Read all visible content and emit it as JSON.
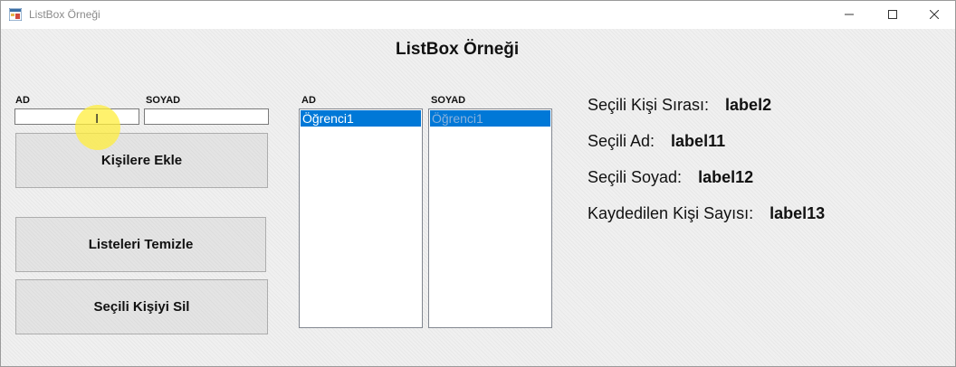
{
  "window": {
    "title": "ListBox Örneği"
  },
  "form": {
    "heading": "ListBox Örneği",
    "ad_label": "AD",
    "soyad_label": "SOYAD",
    "ad_value": "",
    "soyad_value": "",
    "buttons": {
      "add": "Kişilere Ekle",
      "clear": "Listeleri Temizle",
      "delete": "Seçili Kişiyi Sil"
    },
    "list_ad_label": "AD",
    "list_soyad_label": "SOYAD",
    "list_ad_items": [
      "Öğrenci1"
    ],
    "list_soyad_items": [
      "Öğrenci1"
    ],
    "info": {
      "index_label": "Seçili Kişi Sırası:",
      "index_value": "label2",
      "ad_label": "Seçili Ad:",
      "ad_value": "label11",
      "soyad_label": "Seçili Soyad:",
      "soyad_value": "label12",
      "count_label": "Kaydedilen Kişi Sayısı:",
      "count_value": "label13"
    }
  },
  "colors": {
    "selection": "#0078d7",
    "form_bg": "#f0f0f0",
    "cursor_highlight": "#ffee3c"
  },
  "icons": [
    "app-icon",
    "minimize-icon",
    "maximize-icon",
    "close-icon",
    "text-cursor-icon"
  ]
}
